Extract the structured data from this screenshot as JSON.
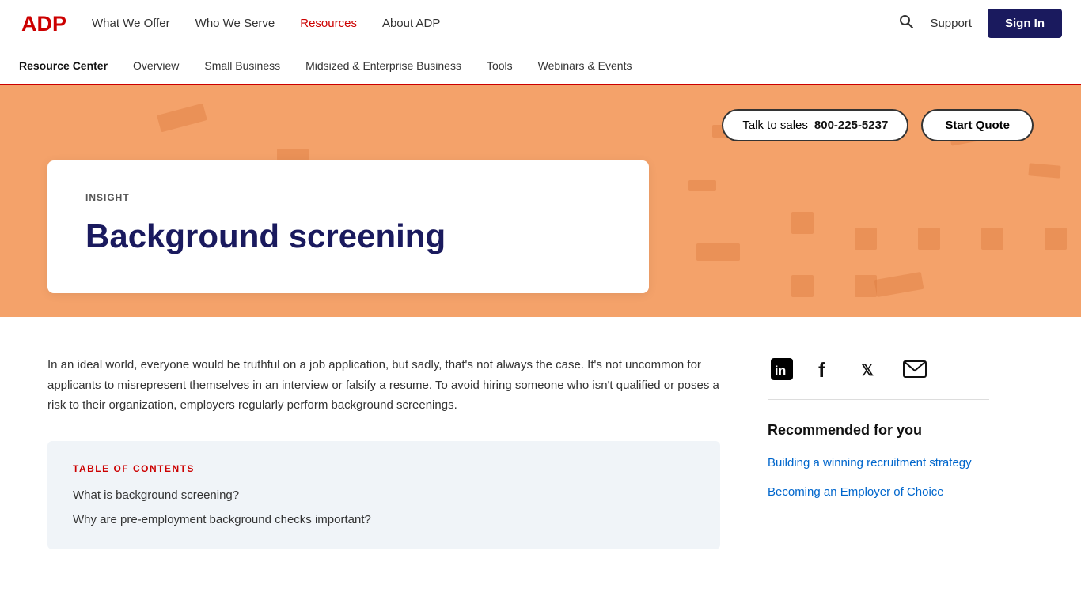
{
  "nav": {
    "logo_alt": "ADP",
    "links": [
      {
        "label": "What We Offer",
        "active": false
      },
      {
        "label": "Who We Serve",
        "active": false
      },
      {
        "label": "Resources",
        "active": true
      },
      {
        "label": "About ADP",
        "active": false
      }
    ],
    "support_label": "Support",
    "sign_in_label": "Sign In"
  },
  "secondary_nav": {
    "items": [
      {
        "label": "Resource Center",
        "bold": true
      },
      {
        "label": "Overview"
      },
      {
        "label": "Small Business"
      },
      {
        "label": "Midsized & Enterprise Business"
      },
      {
        "label": "Tools"
      },
      {
        "label": "Webinars & Events"
      }
    ]
  },
  "hero": {
    "talk_to_sales_label": "Talk to sales",
    "phone_number": "800-225-5237",
    "start_quote_label": "Start Quote",
    "tag": "INSIGHT",
    "title": "Background screening"
  },
  "article": {
    "intro": "In an ideal world, everyone would be truthful on a job application, but sadly, that's not always the case. It's not uncommon for applicants to misrepresent themselves in an interview or falsify a resume. To avoid hiring someone who isn't qualified or poses a risk to their organization, employers regularly perform background screenings.",
    "toc_label": "TABLE OF CONTENTS",
    "toc_items": [
      {
        "text": "What is background screening?",
        "link": true
      },
      {
        "text": "Why are pre-employment background checks important?",
        "link": false
      }
    ]
  },
  "sidebar": {
    "social_icons": [
      {
        "name": "linkedin-icon",
        "symbol": "in"
      },
      {
        "name": "facebook-icon",
        "symbol": "f"
      },
      {
        "name": "twitter-icon",
        "symbol": "𝕏"
      },
      {
        "name": "email-icon",
        "symbol": "✉"
      }
    ],
    "recommended_title": "Recommended for you",
    "recommended_links": [
      {
        "text": "Building a winning recruitment strategy"
      },
      {
        "text": "Becoming an Employer of Choice"
      }
    ]
  },
  "colors": {
    "accent_red": "#cc0000",
    "navy": "#1a1a5e",
    "hero_bg": "#f4a26a",
    "link_blue": "#0066cc"
  }
}
